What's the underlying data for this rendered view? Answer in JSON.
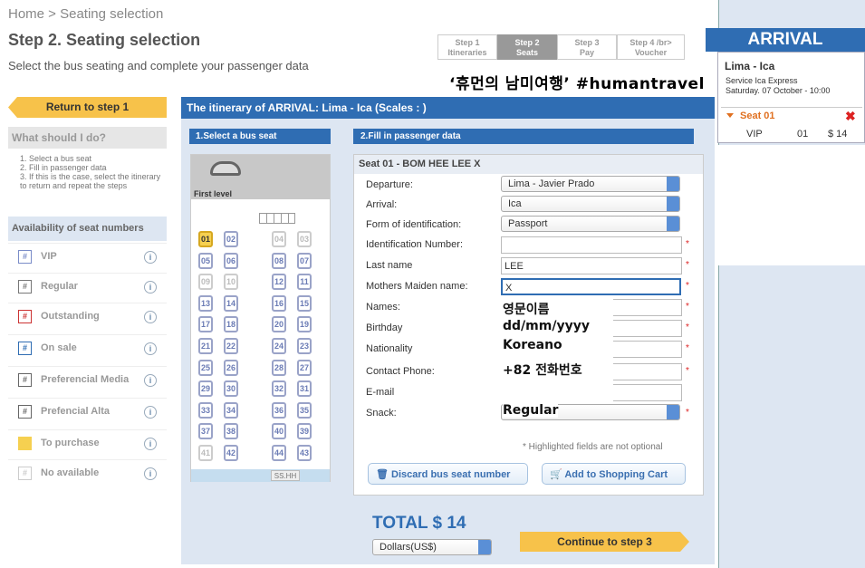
{
  "breadcrumb": "Home > Seating selection",
  "page_title": "Step 2. Seating selection",
  "page_subtitle": "Select the bus seating and complete your passenger data",
  "steps": [
    {
      "line1": "Step 1",
      "line2": "Itineraries"
    },
    {
      "line1": "Step 2",
      "line2": "Seats"
    },
    {
      "line1": "Step 3",
      "line2": "Pay"
    },
    {
      "line1": "Step 4 /br>",
      "line2": "Voucher"
    }
  ],
  "handwritten_note": "‘휴먼의 남미여행’ #humantravel",
  "sidebar": {
    "return_label": "Return to step 1",
    "what_title": "What should I do?",
    "instructions": [
      "1. Select a bus seat",
      "2. Fill in passenger data",
      "3. If this is the case, select the itinerary to return and repeat the steps"
    ],
    "availability_title": "Availability of seat numbers",
    "legend": [
      {
        "label": "VIP",
        "icon": "#",
        "color": "#7a8cc8"
      },
      {
        "label": "Regular",
        "icon": "#",
        "color": "#777777"
      },
      {
        "label": "Outstanding",
        "icon": "#",
        "color": "#cc3333"
      },
      {
        "label": "On sale",
        "icon": "#",
        "color": "#2f6db3"
      },
      {
        "label": "Preferencial Media",
        "icon": "#",
        "color": "#666666"
      },
      {
        "label": "Prefencial Alta",
        "icon": "#",
        "color": "#666666"
      },
      {
        "label": "To purchase",
        "icon": "",
        "color": "#f6d050"
      },
      {
        "label": "No available",
        "icon": "#",
        "color": "#cccccc"
      }
    ],
    "info_icon": "i"
  },
  "itinerary_bar": "The itinerary of ARRIVAL: Lima - Ica (Scales : )",
  "section1_title": "1.Select a bus seat",
  "section2_title": "2.Fill in passenger data",
  "bus": {
    "level_label": "First level",
    "footer_label": "SS.HH",
    "rows": [
      [
        "01",
        "02",
        "",
        "04",
        "03"
      ],
      [
        "05",
        "06",
        "",
        "08",
        "07"
      ],
      [
        "09",
        "10",
        "",
        "12",
        "11"
      ],
      [
        "13",
        "14",
        "",
        "16",
        "15"
      ],
      [
        "17",
        "18",
        "",
        "20",
        "19"
      ],
      [
        "21",
        "22",
        "",
        "24",
        "23"
      ],
      [
        "25",
        "26",
        "",
        "28",
        "27"
      ],
      [
        "29",
        "30",
        "",
        "32",
        "31"
      ],
      [
        "33",
        "34",
        "",
        "36",
        "35"
      ],
      [
        "37",
        "38",
        "",
        "40",
        "39"
      ],
      [
        "41",
        "42",
        "",
        "44",
        "43"
      ]
    ],
    "selected": [
      "01"
    ],
    "unavailable": [
      "04",
      "03",
      "09",
      "10",
      "41"
    ]
  },
  "form": {
    "header": "Seat 01 - BOM HEE LEE X",
    "labels": {
      "departure": "Departure:",
      "arrival": "Arrival:",
      "id_form": "Form of identification:",
      "id_number": "Identification Number:",
      "last_name": "Last name",
      "maiden": "Mothers Maiden name:",
      "names": "Names:",
      "birthday": "Birthday",
      "nationality": "Nationality",
      "phone": "Contact Phone:",
      "email": "E-mail",
      "snack": "Snack:"
    },
    "values": {
      "departure": "Lima - Javier Prado",
      "arrival": "Ica",
      "id_form": "Passport",
      "id_number": "",
      "last_name": "LEE",
      "maiden": "X"
    },
    "handwritten": {
      "names": "영문이름",
      "birthday": "dd/mm/yyyy",
      "nationality": "Koreano",
      "phone": "+82 전화번호",
      "snack": "Regular"
    },
    "required_mark": "*",
    "note": "* Highlighted fields are not optional",
    "discard_label": "Discard bus seat number",
    "cart_label": "Add to Shopping Cart"
  },
  "total": "TOTAL $ 14",
  "currency": "Dollars(US$)",
  "continue_label": "Continue to step 3",
  "arrival_panel": {
    "title": "ARRIVAL",
    "route": "Lima - Ica",
    "service": "Service Ica Express",
    "datetime": "Saturday. 07 October - 10:00",
    "seat_label": "Seat 01",
    "class": "VIP",
    "seat_no": "01",
    "price": "$ 14"
  }
}
